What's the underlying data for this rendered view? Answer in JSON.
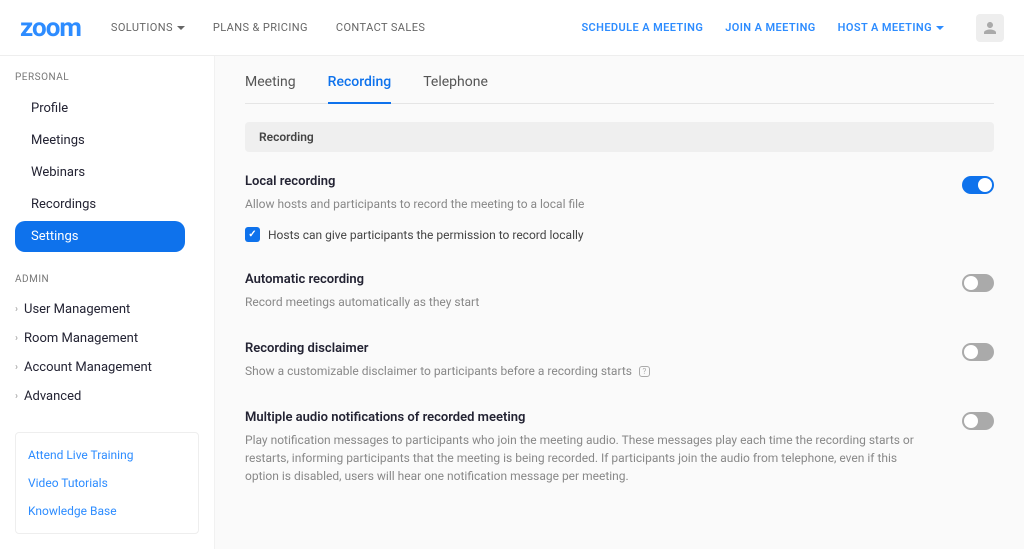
{
  "header": {
    "logo": "zoom",
    "nav_left": [
      {
        "label": "SOLUTIONS",
        "dropdown": true
      },
      {
        "label": "PLANS & PRICING",
        "dropdown": false
      },
      {
        "label": "CONTACT SALES",
        "dropdown": false
      }
    ],
    "nav_right": [
      {
        "label": "SCHEDULE A MEETING",
        "dropdown": false
      },
      {
        "label": "JOIN A MEETING",
        "dropdown": false
      },
      {
        "label": "HOST A MEETING",
        "dropdown": true
      }
    ]
  },
  "sidebar": {
    "personal_title": "PERSONAL",
    "personal_items": [
      {
        "label": "Profile",
        "active": false
      },
      {
        "label": "Meetings",
        "active": false
      },
      {
        "label": "Webinars",
        "active": false
      },
      {
        "label": "Recordings",
        "active": false
      },
      {
        "label": "Settings",
        "active": true
      }
    ],
    "admin_title": "ADMIN",
    "admin_items": [
      {
        "label": "User Management"
      },
      {
        "label": "Room Management"
      },
      {
        "label": "Account Management"
      },
      {
        "label": "Advanced"
      }
    ],
    "help": [
      {
        "label": "Attend Live Training"
      },
      {
        "label": "Video Tutorials"
      },
      {
        "label": "Knowledge Base"
      }
    ]
  },
  "tabs": [
    {
      "label": "Meeting",
      "active": false
    },
    {
      "label": "Recording",
      "active": true
    },
    {
      "label": "Telephone",
      "active": false
    }
  ],
  "section_header": "Recording",
  "settings": [
    {
      "title": "Local recording",
      "desc": "Allow hosts and participants to record the meeting to a local file",
      "toggle": true,
      "checkbox_label": "Hosts can give participants the permission to record locally"
    },
    {
      "title": "Automatic recording",
      "desc": "Record meetings automatically as they start",
      "toggle": false
    },
    {
      "title": "Recording disclaimer",
      "desc": "Show a customizable disclaimer to participants before a recording starts",
      "toggle": false,
      "info_icon": true
    },
    {
      "title": "Multiple audio notifications of recorded meeting",
      "desc": "Play notification messages to participants who join the meeting audio. These messages play each time the recording starts or restarts, informing participants that the meeting is being recorded. If participants join the audio from telephone, even if this option is disabled, users will hear one notification message per meeting.",
      "toggle": false
    }
  ]
}
